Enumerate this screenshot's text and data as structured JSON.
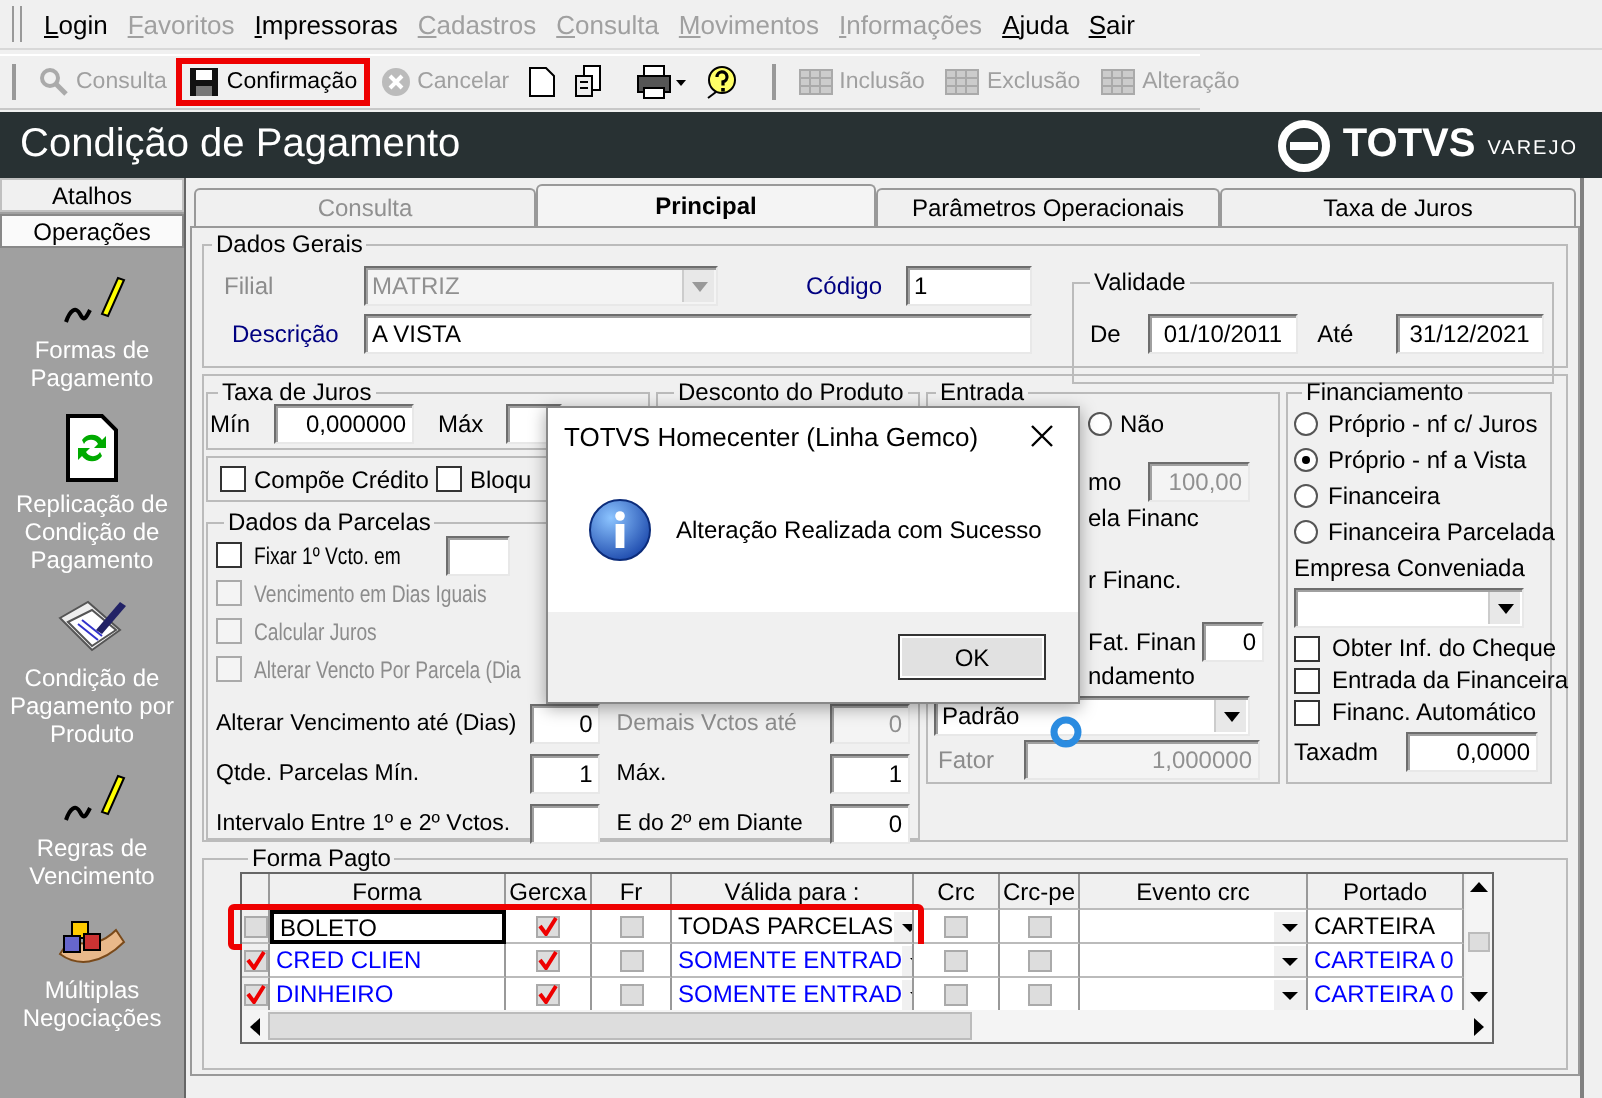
{
  "menu": [
    {
      "label": "Login",
      "disabled": false
    },
    {
      "label": "Favoritos",
      "disabled": true
    },
    {
      "label": "Impressoras",
      "disabled": false
    },
    {
      "label": "Cadastros",
      "disabled": true
    },
    {
      "label": "Consulta",
      "disabled": true
    },
    {
      "label": "Movimentos",
      "disabled": true
    },
    {
      "label": "Informações",
      "disabled": true
    },
    {
      "label": "Ajuda",
      "disabled": false
    },
    {
      "label": "Sair",
      "disabled": false
    }
  ],
  "toolbar": {
    "main": [
      {
        "label": "Consulta",
        "disabled": true,
        "highlighted": false
      },
      {
        "label": "Confirmação",
        "disabled": false,
        "highlighted": true
      },
      {
        "label": "Cancelar",
        "disabled": true,
        "highlighted": false
      }
    ],
    "records": [
      {
        "label": "Inclusão",
        "disabled": true
      },
      {
        "label": "Exclusão",
        "disabled": true
      },
      {
        "label": "Alteração",
        "disabled": true
      }
    ]
  },
  "header": {
    "title": "Condição de Pagamento",
    "logo": "TOTVS",
    "logo_suffix": "VAREJO"
  },
  "sidebar": {
    "tabs": [
      {
        "label": "Atalhos",
        "selected": false
      },
      {
        "label": "Operações",
        "selected": true
      }
    ],
    "items": [
      {
        "label": "Formas de Pagamento"
      },
      {
        "label": "Replicação de Condição de Pagamento"
      },
      {
        "label": "Condição de Pagamento por Produto"
      },
      {
        "label": "Regras de Vencimento"
      },
      {
        "label": "Múltiplas Negociações"
      }
    ]
  },
  "tabs": [
    {
      "label": "Consulta",
      "selected": false,
      "disabled": true
    },
    {
      "label": "Principal",
      "selected": true,
      "disabled": false
    },
    {
      "label": "Parâmetros Operacionais",
      "selected": false,
      "disabled": false
    },
    {
      "label": "Taxa de Juros",
      "selected": false,
      "disabled": false
    }
  ],
  "dados_gerais": {
    "title": "Dados Gerais",
    "filial_label": "Filial",
    "filial": "MATRIZ",
    "filial_disabled": true,
    "codigo_label": "Código",
    "codigo": "1",
    "descricao_label": "Descrição",
    "descricao": "A VISTA"
  },
  "validade": {
    "title": "Validade",
    "de_label": "De",
    "de": "01/10/2011",
    "ate_label": "Até",
    "ate": "31/12/2021"
  },
  "taxa_juros": {
    "title": "Taxa de Juros",
    "min_label": "Mín",
    "min": "0,000000",
    "max_label": "Máx"
  },
  "desconto_produto": {
    "title": "Desconto do Produto"
  },
  "opcoes": [
    {
      "label": "Compõe Crédito",
      "checked": false
    },
    {
      "label": "Bloqu",
      "checked": false
    }
  ],
  "dados_parcelas": {
    "title": "Dados da Parcelas",
    "checks": [
      {
        "label": "Fixar 1º Vcto. em",
        "checked": false,
        "disabled": false
      },
      {
        "label": "Vencimento em Dias Iguais",
        "checked": false,
        "disabled": true
      },
      {
        "label": "Calcular Juros",
        "checked": false,
        "disabled": true
      },
      {
        "label": "Alterar Vencto Por Parcela (Dia",
        "checked": false,
        "disabled": true
      }
    ],
    "fields": [
      {
        "label": "Alterar Vencimento até (Dias)",
        "value": "0",
        "label_2": "Demais Vctos até",
        "value_2": "0",
        "disabled_2": true
      },
      {
        "label": "Qtde. Parcelas Mín.",
        "value": "1",
        "label_2": "Máx.",
        "value_2": "1",
        "disabled_2": false
      },
      {
        "label": "Intervalo Entre 1º e 2º Vctos.",
        "label_2": "E do 2º em Diante",
        "value_2": "0",
        "disabled_2": false
      }
    ]
  },
  "entrada": {
    "title": "Entrada",
    "nao": {
      "label": "Não",
      "selected": false
    },
    "minimo_tail": "mo",
    "minimo": "100,00",
    "parcela_tail": "ela Financ",
    "financ_tail": "r Financ.",
    "fat_label": "Fat. Finan",
    "fat": "0",
    "arred_tail": "ndamento",
    "arredondamento": "Padrão",
    "fator_label": "Fator",
    "fator": "1,000000"
  },
  "financiamento": {
    "title": "Financiamento",
    "options": [
      {
        "label": "Próprio - nf c/ Juros",
        "selected": false
      },
      {
        "label": "Próprio - nf a Vista",
        "selected": true
      },
      {
        "label": "Financeira",
        "selected": false
      },
      {
        "label": "Financeira Parcelada",
        "selected": false
      }
    ],
    "empresa_label": "Empresa Conveniada",
    "checks": [
      {
        "label": "Obter Inf. do Cheque",
        "checked": false
      },
      {
        "label": "Entrada da Financeira",
        "checked": false
      },
      {
        "label": "Financ. Automático",
        "checked": false
      }
    ],
    "taxadm_label": "Taxadm",
    "taxadm": "0,0000"
  },
  "forma_pagto": {
    "title": "Forma Pagto",
    "columns": [
      "Forma",
      "Gercxa",
      "Fr",
      "Válida para :",
      "Crc",
      "Crc-pe",
      "Evento crc",
      "Portado"
    ],
    "rows": [
      {
        "marked": false,
        "forma": "BOLETO",
        "gercxa": true,
        "fr": false,
        "valida": "TODAS PARCELAS",
        "crc": false,
        "crc_pe": false,
        "portador": "CARTEIRA",
        "selected": true,
        "highlighted": true
      },
      {
        "marked": true,
        "forma": "CRED CLIEN",
        "gercxa": true,
        "fr": false,
        "valida": "SOMENTE ENTRAD",
        "crc": false,
        "crc_pe": false,
        "portador": "CARTEIRA 0",
        "selected": false,
        "highlighted": false
      },
      {
        "marked": true,
        "forma": "DINHEIRO",
        "gercxa": true,
        "fr": false,
        "valida": "SOMENTE ENTRAD",
        "crc": false,
        "crc_pe": false,
        "portador": "CARTEIRA 0",
        "selected": false,
        "highlighted": false
      }
    ]
  },
  "dialog": {
    "title": "TOTVS Homecenter (Linha Gemco)",
    "message": "Alteração Realizada com Sucesso",
    "button": "OK"
  }
}
